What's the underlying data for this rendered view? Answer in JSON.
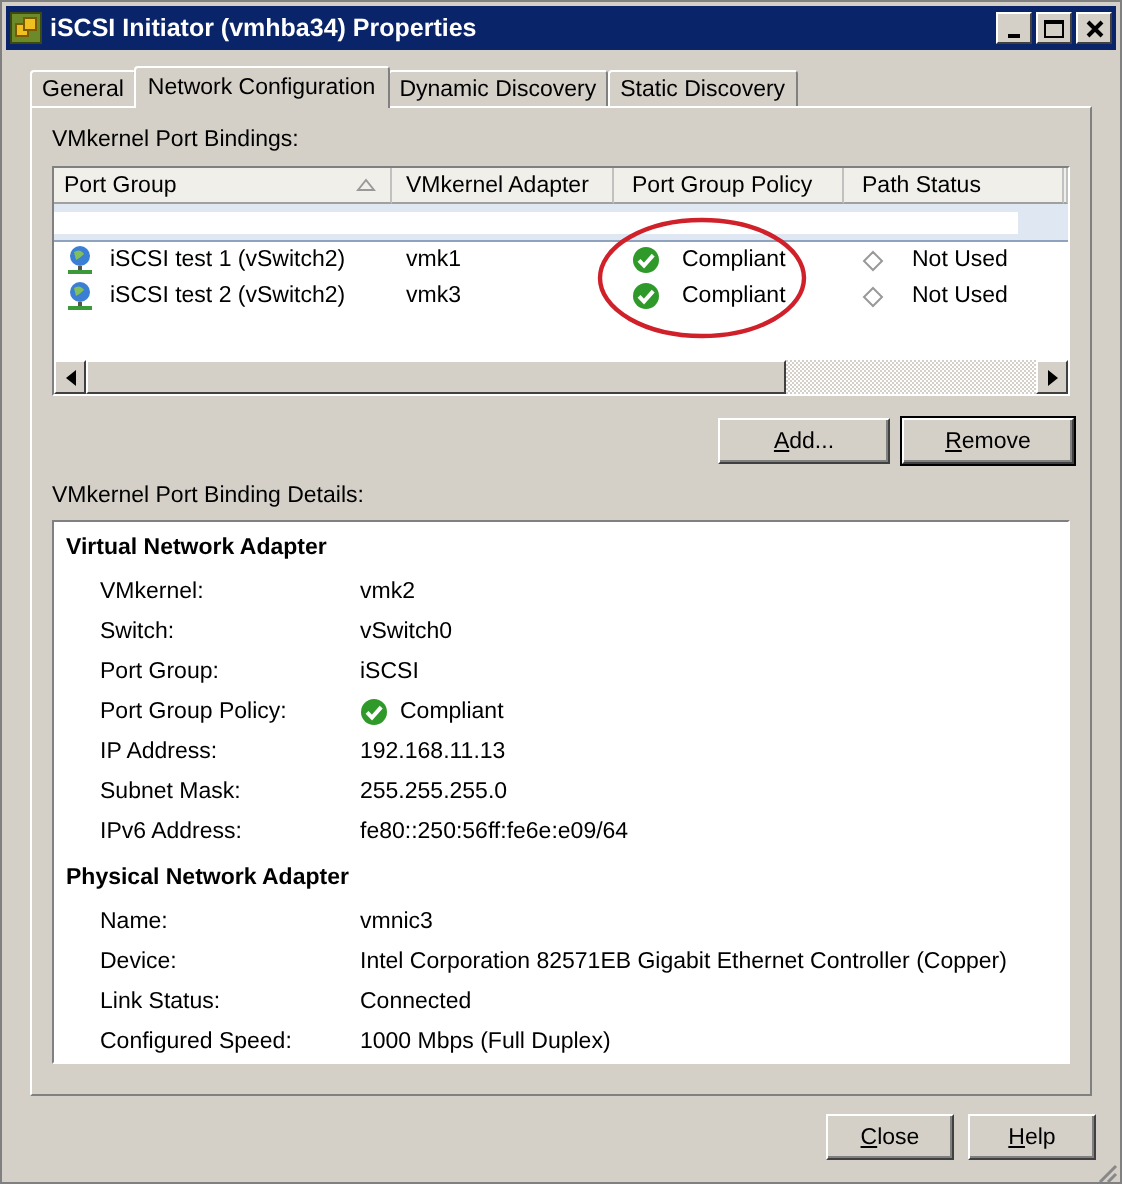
{
  "window": {
    "title": "iSCSI Initiator (vmhba34) Properties"
  },
  "tabs": [
    {
      "label": "General",
      "selected": false
    },
    {
      "label": "Network Configuration",
      "selected": true
    },
    {
      "label": "Dynamic Discovery",
      "selected": false
    },
    {
      "label": "Static Discovery",
      "selected": false
    }
  ],
  "bindings": {
    "label": "VMkernel Port Bindings:",
    "columns": [
      "Port Group",
      "VMkernel Adapter",
      "Port Group Policy",
      "Path Status"
    ],
    "rows": [
      {
        "kind": "obscured",
        "selected": true
      },
      {
        "kind": "binding",
        "selected": false,
        "port_group": "iSCSI test 1 (vSwitch2)",
        "adapter": "vmk1",
        "policy": "Compliant",
        "path_status": "Not Used"
      },
      {
        "kind": "binding",
        "selected": false,
        "port_group": "iSCSI test 2 (vSwitch2)",
        "adapter": "vmk3",
        "policy": "Compliant",
        "path_status": "Not Used"
      }
    ]
  },
  "binding_buttons": [
    {
      "label": "Add...",
      "focused": false
    },
    {
      "label": "Remove",
      "focused": true
    }
  ],
  "details": {
    "label": "VMkernel Port Binding Details:",
    "sections": [
      {
        "title": "Virtual Network Adapter",
        "fields": [
          {
            "kind": "text",
            "label": "VMkernel:",
            "value": "vmk2"
          },
          {
            "kind": "text",
            "label": "Switch:",
            "value": "vSwitch0"
          },
          {
            "kind": "text",
            "label": "Port Group:",
            "value": "iSCSI"
          },
          {
            "kind": "status",
            "label": "Port Group Policy:",
            "value": "Compliant"
          },
          {
            "kind": "text",
            "label": "IP Address:",
            "value": "192.168.11.13"
          },
          {
            "kind": "text",
            "label": "Subnet Mask:",
            "value": "255.255.255.0"
          },
          {
            "kind": "text",
            "label": "IPv6 Address:",
            "value": "fe80::250:56ff:fe6e:e09/64"
          }
        ]
      },
      {
        "title": "Physical Network Adapter",
        "fields": [
          {
            "kind": "text",
            "label": "Name:",
            "value": "vmnic3"
          },
          {
            "kind": "text",
            "label": "Device:",
            "value": "Intel Corporation 82571EB Gigabit Ethernet Controller (Copper)"
          },
          {
            "kind": "text",
            "label": "Link Status:",
            "value": "Connected"
          },
          {
            "kind": "text",
            "label": "Configured Speed:",
            "value": "1000 Mbps (Full Duplex)"
          }
        ]
      }
    ]
  },
  "footer_buttons": [
    "Close",
    "Help"
  ]
}
